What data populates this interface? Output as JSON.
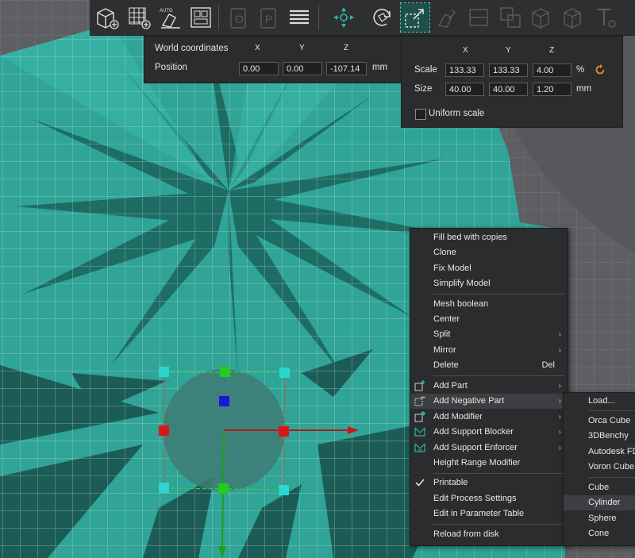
{
  "toolbar": {
    "buttons": [
      {
        "name": "add-cube-icon",
        "active": false,
        "enabled": true
      },
      {
        "name": "add-plate-icon",
        "active": false,
        "enabled": true
      },
      {
        "name": "auto-orient-icon",
        "active": false,
        "enabled": true
      },
      {
        "name": "arrange-icon",
        "active": false,
        "enabled": true
      },
      {
        "name": "split-objects-icon",
        "active": false,
        "enabled": false
      },
      {
        "name": "split-parts-icon",
        "active": false,
        "enabled": false
      },
      {
        "name": "layers-icon",
        "active": false,
        "enabled": true
      },
      {
        "name": "move-icon",
        "active": false,
        "enabled": true
      },
      {
        "name": "rotate-icon",
        "active": false,
        "enabled": true
      },
      {
        "name": "scale-icon",
        "active": true,
        "enabled": true
      },
      {
        "name": "lay-on-face-icon",
        "active": false,
        "enabled": false
      },
      {
        "name": "cut-icon",
        "active": false,
        "enabled": false
      },
      {
        "name": "mesh-boolean-icon",
        "active": false,
        "enabled": false
      },
      {
        "name": "support-paint-icon",
        "active": false,
        "enabled": false
      },
      {
        "name": "seam-paint-icon",
        "active": false,
        "enabled": false
      },
      {
        "name": "text-icon",
        "active": false,
        "enabled": false
      }
    ],
    "auto_badge": "AUTO"
  },
  "coordinates": {
    "title": "World coordinates",
    "axis_x": "X",
    "axis_y": "Y",
    "axis_z": "Z",
    "position_label": "Position",
    "x": "0.00",
    "y": "0.00",
    "z": "-107.14",
    "unit": "mm"
  },
  "scale": {
    "axis_x": "X",
    "axis_y": "Y",
    "axis_z": "Z",
    "scale_label": "Scale",
    "scale_x": "133.33",
    "scale_y": "133.33",
    "scale_z": "4.00",
    "scale_unit": "%",
    "size_label": "Size",
    "size_x": "40.00",
    "size_y": "40.00",
    "size_z": "1.20",
    "size_unit": "mm",
    "uniform_label": "Uniform scale",
    "uniform_checked": false
  },
  "context_menu": {
    "fill_bed": "Fill bed with copies",
    "clone": "Clone",
    "fix_model": "Fix Model",
    "simplify_model": "Simplify Model",
    "mesh_boolean": "Mesh boolean",
    "center": "Center",
    "split": "Split",
    "mirror": "Mirror",
    "delete": "Delete",
    "delete_shortcut": "Del",
    "add_part": "Add Part",
    "add_negative_part": "Add Negative Part",
    "add_modifier": "Add Modifier",
    "add_support_blocker": "Add Support Blocker",
    "add_support_enforcer": "Add Support Enforcer",
    "height_range_modifier": "Height Range Modifier",
    "printable": "Printable",
    "edit_process_settings": "Edit Process Settings",
    "edit_in_parameter_table": "Edit in Parameter Table",
    "reload_from_disk": "Reload from disk"
  },
  "submenu": {
    "load": "Load...",
    "orca_cube": "Orca Cube",
    "benchy": "3DBenchy",
    "autodesk": "Autodesk FD",
    "voron_cube": "Voron Cube",
    "cube": "Cube",
    "cylinder": "Cylinder",
    "sphere": "Sphere",
    "cone": "Cone"
  },
  "colors": {
    "model": "#2a9d8f",
    "bed_grid": "#9fbfbf",
    "accent_orange": "#f08a24",
    "axis_x": "#e0463b",
    "axis_y": "#3fb24a",
    "axis_z": "#3a6cf0"
  }
}
